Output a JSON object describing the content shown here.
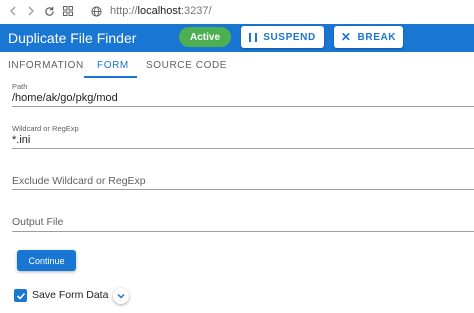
{
  "browser": {
    "url_scheme": "http://",
    "url_host": "localhost",
    "url_rest": ":3237/"
  },
  "header": {
    "title": "Duplicate File Finder",
    "status_badge": "Active",
    "suspend_label": "SUSPEND",
    "break_label": "BREAK",
    "accent_color": "#1976d2",
    "badge_color": "#4caf50"
  },
  "tabs": [
    {
      "label": "INFORMATION"
    },
    {
      "label": "FORM"
    },
    {
      "label": "SOURCE CODE"
    }
  ],
  "active_tab": "FORM",
  "form": {
    "path": {
      "label": "Path",
      "value": "/home/ak/go/pkg/mod"
    },
    "wildcard": {
      "label": "Wildcard or RegExp",
      "value": "*.ini"
    },
    "exclude": {
      "placeholder": "Exclude Wildcard or RegExp"
    },
    "output": {
      "placeholder": "Output File"
    },
    "continue_label": "Continue",
    "save_form_data": {
      "label": "Save Form Data",
      "checked": true
    }
  }
}
